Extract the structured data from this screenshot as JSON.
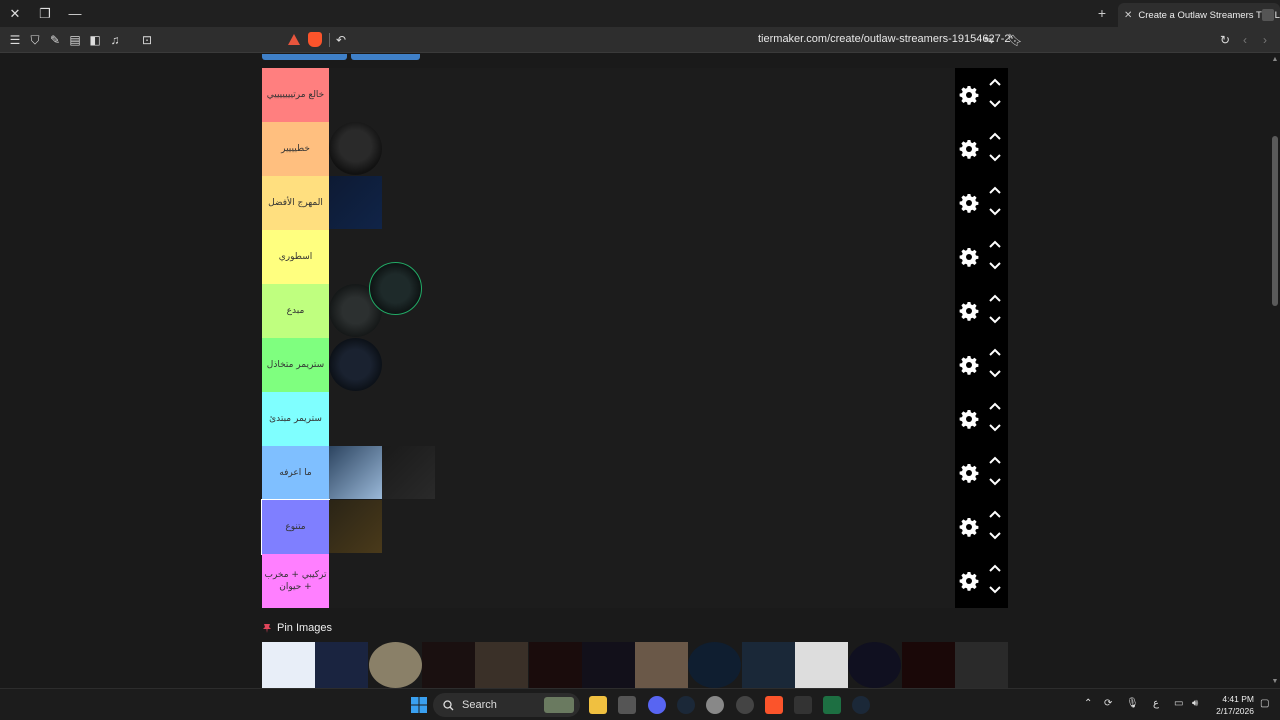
{
  "browser": {
    "tab_title": "Create a Outlaw Streamers Tier L",
    "url": "tiermaker.com/create/outlaw-streamers-19154627-2"
  },
  "tiers": [
    {
      "label": "خالع مرتيييييييي",
      "color": "#ff7f7f"
    },
    {
      "label": "خطيييير",
      "color": "#ffbf7f"
    },
    {
      "label": "المهرج الأفضل",
      "color": "#ffdf7f"
    },
    {
      "label": "اسطوري",
      "color": "#ffff7f"
    },
    {
      "label": "مبدع",
      "color": "#bfff7f"
    },
    {
      "label": "ستريمر متخاذل",
      "color": "#7fff7f"
    },
    {
      "label": "ستريمر مبتدئ",
      "color": "#7fffff"
    },
    {
      "label": "ما اعرفه",
      "color": "#7fbfff"
    },
    {
      "label": "متنوع",
      "color": "#7f7fff"
    },
    {
      "label": "تركيبي + مخرب + حيوان",
      "color": "#ff7fff"
    }
  ],
  "pin_section": {
    "title": "Pin Images",
    "icon": "pin-icon"
  },
  "taskbar": {
    "search_placeholder": "Search",
    "time": "4:41 PM",
    "date": "2/17/2026",
    "lang": "ع"
  },
  "colors": {
    "accent_blue": "#3f80c8",
    "control_bg": "#000000"
  }
}
